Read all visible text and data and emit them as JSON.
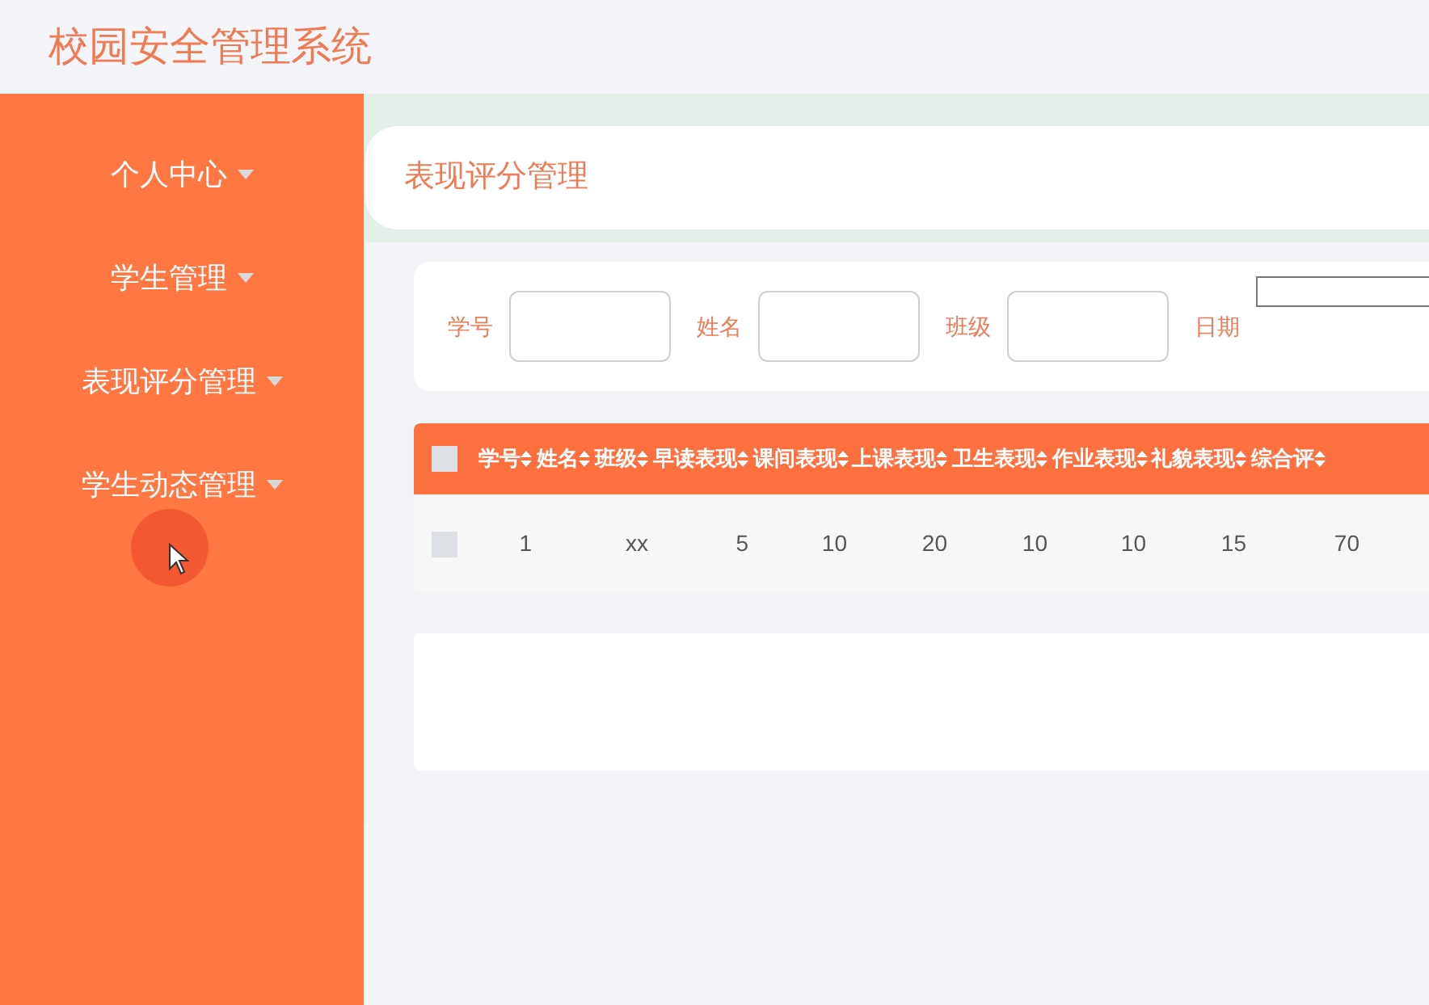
{
  "app_title": "校园安全管理系统",
  "sidebar": {
    "items": [
      {
        "label": "个人中心",
        "expanded": false
      },
      {
        "label": "学生管理",
        "expanded": false
      },
      {
        "label": "表现评分管理",
        "expanded": false
      },
      {
        "label": "学生动态管理",
        "expanded": false
      }
    ]
  },
  "breadcrumb": "表现评分管理",
  "search": {
    "fields": [
      {
        "label": "学号",
        "kind": "text"
      },
      {
        "label": "姓名",
        "kind": "text"
      },
      {
        "label": "班级",
        "kind": "text"
      },
      {
        "label": "日期",
        "kind": "date"
      }
    ]
  },
  "table": {
    "all_checked": false,
    "columns": [
      "学号",
      "姓名",
      "班级",
      "早读表现",
      "课间表现",
      "上课表现",
      "卫生表现",
      "作业表现",
      "礼貌表现",
      "综合评"
    ],
    "rows": [
      {
        "checked": false,
        "cells": [
          "1",
          "",
          "xx",
          "5",
          "10",
          "20",
          "10",
          "10",
          "15",
          "70"
        ]
      }
    ]
  }
}
